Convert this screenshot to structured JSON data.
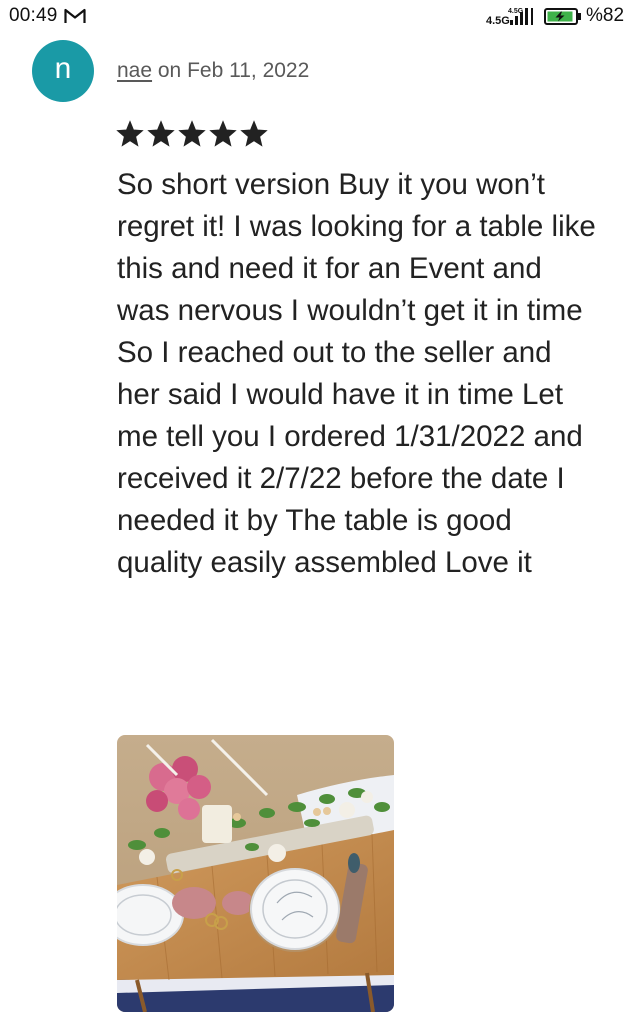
{
  "status_bar": {
    "time": "00:49",
    "network_label": "4.5G",
    "battery_label": "%82",
    "icons": [
      "gmail-icon",
      "network-signal-icon",
      "battery-charging-icon"
    ]
  },
  "review": {
    "avatar_letter": "n",
    "author": "nae",
    "date_text": " on Feb 11, 2022",
    "rating": 5,
    "rating_max": 5,
    "star_glyph": "★★★★★",
    "text": "So short version Buy it you won’t regret it! I was looking for a table like this and need it for an Event and was nervous I wouldn’t get it in time So I reached out to the seller and her said I would have it in time Let me tell you I ordered 1/31/2022 and received it 2/7/22 before the date I needed it by The table is good quality easily assembled Love it"
  },
  "colors": {
    "avatar_bg": "#1a9aa6",
    "text": "#222222",
    "muted_text": "#595959",
    "battery_fill": "#3fb24a"
  }
}
